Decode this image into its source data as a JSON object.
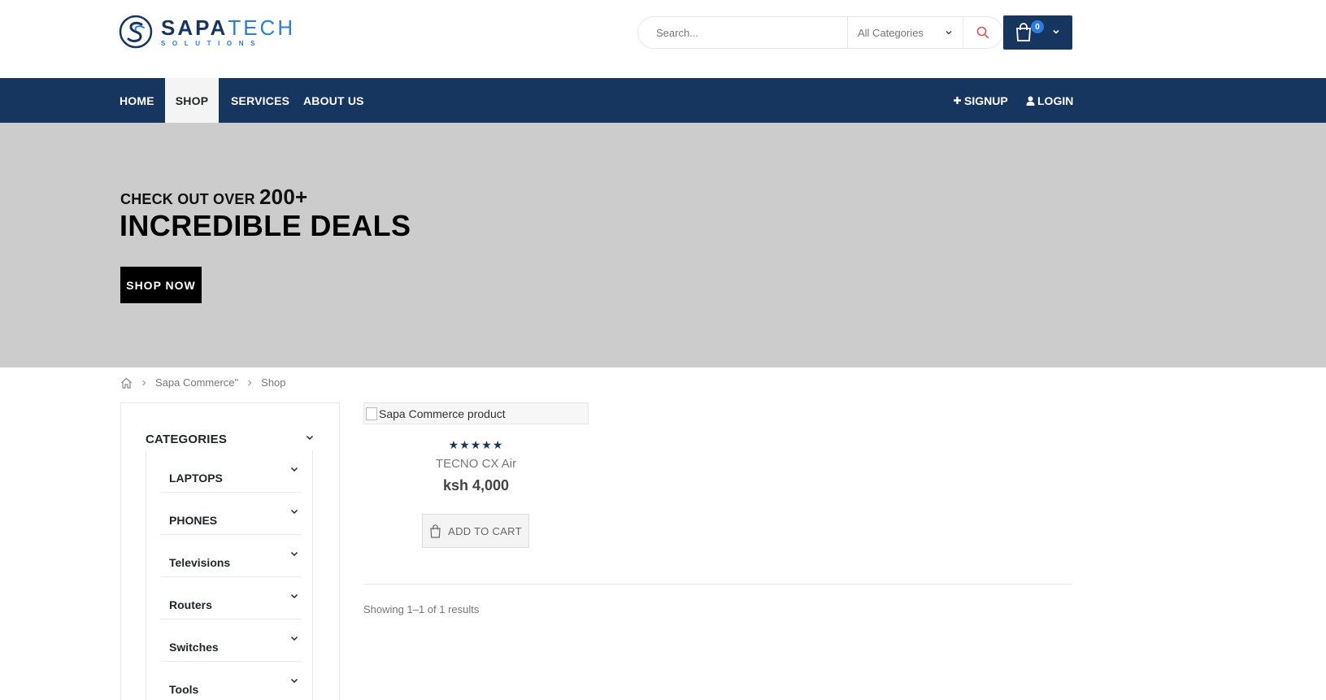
{
  "header": {
    "logo": {
      "brand_bold": "SAPA",
      "brand_light": "TECH",
      "tagline": "SOLUTIONS"
    },
    "search": {
      "placeholder": "Search...",
      "category": "All Categories"
    },
    "cart": {
      "count": "0"
    }
  },
  "nav": {
    "items": [
      {
        "label": "HOME"
      },
      {
        "label": "SHOP",
        "active": true
      },
      {
        "label": "SERVICES"
      },
      {
        "label": "ABOUT US"
      }
    ],
    "signup": "SIGNUP",
    "login": "LOGIN"
  },
  "banner": {
    "line1_prefix": "CHECK OUT OVER",
    "line1_highlight": "200+",
    "line2": "INCREDIBLE DEALS",
    "cta": "SHOP NOW"
  },
  "breadcrumb": {
    "items": [
      "Sapa Commerce\"",
      "Shop"
    ]
  },
  "sidebar": {
    "title": "CATEGORIES",
    "items": [
      {
        "label": "LAPTOPS"
      },
      {
        "label": "PHONES"
      },
      {
        "label": "Televisions"
      },
      {
        "label": "Routers"
      },
      {
        "label": "Switches"
      },
      {
        "label": "Tools"
      }
    ]
  },
  "product": {
    "image_alt": "Sapa Commerce product",
    "rating": 5,
    "rating_max": 5,
    "name": "TECNO CX Air",
    "price": "ksh 4,000",
    "add_to_cart": "ADD TO CART"
  },
  "results": {
    "text": "Showing 1–1 of 1 results"
  },
  "colors": {
    "primary": "#17365f",
    "accent": "#2a7de1",
    "banner_bg": "#cccccc",
    "search_icon": "#e9504f"
  }
}
